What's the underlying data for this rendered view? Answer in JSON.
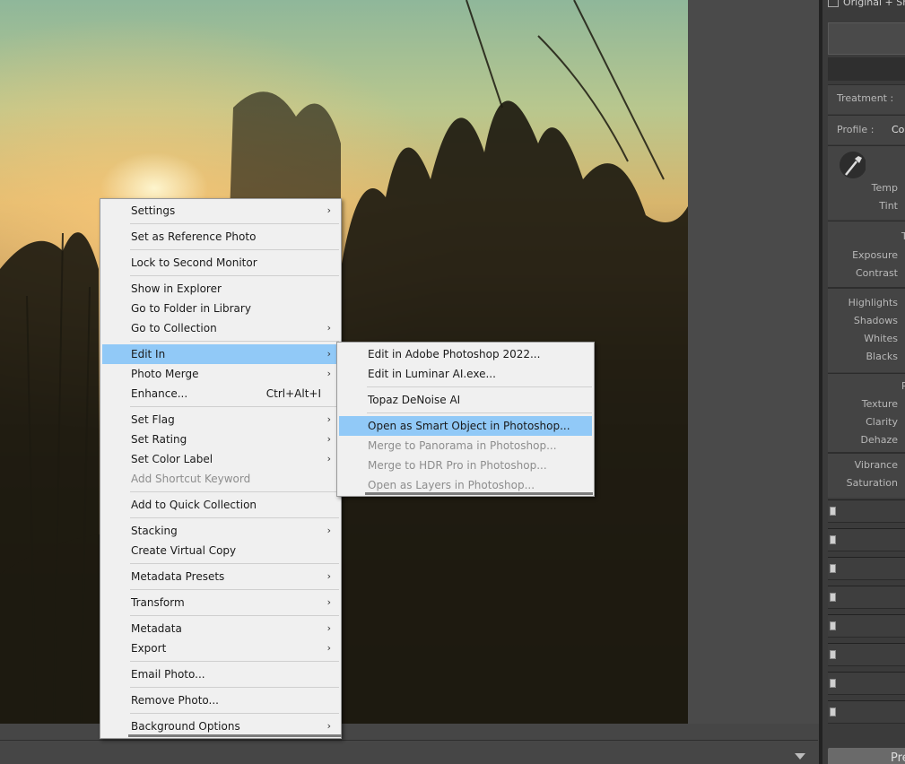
{
  "right_panel": {
    "top_label": "Original + Sn",
    "treatment_label": "Treatment :",
    "profile_label": "Profile :",
    "profile_value": "Col",
    "temp_label": "Temp",
    "tint_label": "Tint",
    "tone_header": "T",
    "exposure_label": "Exposure",
    "contrast_label": "Contrast",
    "highlights_label": "Highlights",
    "shadows_label": "Shadows",
    "whites_label": "Whites",
    "blacks_label": "Blacks",
    "presence_header": "P",
    "texture_label": "Texture",
    "clarity_label": "Clarity",
    "dehaze_label": "Dehaze",
    "vibrance_label": "Vibrance",
    "saturation_label": "Saturation",
    "preview_button": "Prev"
  },
  "context_menu": {
    "settings": "Settings",
    "set_reference": "Set as Reference Photo",
    "lock_monitor": "Lock to Second Monitor",
    "show_explorer": "Show in Explorer",
    "go_folder": "Go to Folder in Library",
    "go_collection": "Go to Collection",
    "edit_in": "Edit In",
    "photo_merge": "Photo Merge",
    "enhance": "Enhance...",
    "enhance_shortcut": "Ctrl+Alt+I",
    "set_flag": "Set Flag",
    "set_rating": "Set Rating",
    "set_color_label": "Set Color Label",
    "add_shortcut_keyword": "Add Shortcut Keyword",
    "add_quick_collection": "Add to Quick Collection",
    "stacking": "Stacking",
    "create_virtual_copy": "Create Virtual Copy",
    "metadata_presets": "Metadata Presets",
    "transform": "Transform",
    "metadata": "Metadata",
    "export": "Export",
    "email_photo": "Email Photo...",
    "remove_photo": "Remove Photo...",
    "background_options": "Background Options"
  },
  "edit_in_submenu": {
    "photoshop_2022": "Edit in Adobe Photoshop 2022...",
    "luminar": "Edit in Luminar AI.exe...",
    "topaz": "Topaz DeNoise AI",
    "smart_object": "Open as Smart Object in Photoshop...",
    "panorama": "Merge to Panorama in Photoshop...",
    "hdr_pro": "Merge to HDR Pro in Photoshop...",
    "layers": "Open as Layers in Photoshop..."
  },
  "colors": {
    "highlight": "#91c9f7",
    "menu_bg": "#f0f0f0",
    "panel_bg": "#3b3b3b"
  }
}
